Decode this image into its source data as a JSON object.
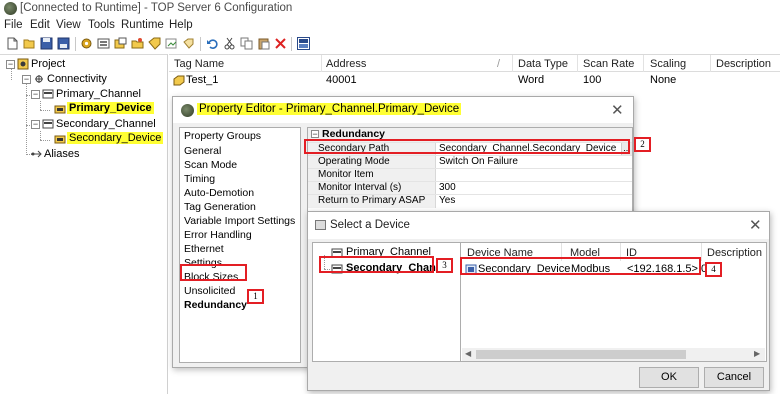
{
  "window": {
    "title": "[Connected to Runtime] - TOP Server 6 Configuration"
  },
  "menu": [
    "File",
    "Edit",
    "View",
    "Tools",
    "Runtime",
    "Help"
  ],
  "toolbar": {
    "icons": [
      "new-icon",
      "open-icon",
      "save-icon",
      "save-as-icon",
      "properties-icon",
      "new-channel-icon",
      "new-device-icon",
      "new-tag-group-icon",
      "new-tag-icon",
      "bulk-tag-icon",
      "undo-icon",
      "cut-icon",
      "copy-icon",
      "paste-icon",
      "delete-icon",
      "quick-client-icon"
    ]
  },
  "tree": {
    "project": "Project",
    "connectivity": "Connectivity",
    "primary_channel": "Primary_Channel",
    "primary_device": "Primary_Device",
    "secondary_channel": "Secondary_Channel",
    "secondary_device": "Secondary_Device",
    "aliases": "Aliases"
  },
  "grid": {
    "columns": [
      "Tag Name",
      "Address",
      "Data Type",
      "Scan Rate",
      "Scaling",
      "Description"
    ],
    "rows": [
      {
        "tag": "Test_1",
        "address": "40001",
        "data_type": "Word",
        "scan_rate": "100",
        "scaling": "None",
        "description": ""
      }
    ]
  },
  "property_editor": {
    "title": "Property Editor - Primary_Channel.Primary_Device",
    "groups": [
      "Property Groups",
      "General",
      "Scan Mode",
      "Timing",
      "Auto-Demotion",
      "Tag Generation",
      "Variable Import Settings",
      "Error Handling",
      "Ethernet",
      "Settings",
      "Block Sizes",
      "Unsolicited",
      "Redundancy"
    ],
    "section": "Redundancy",
    "properties": [
      {
        "key": "Secondary Path",
        "value": "Secondary_Channel.Secondary_Device"
      },
      {
        "key": "Operating Mode",
        "value": "Switch On Failure"
      },
      {
        "key": "Monitor Item",
        "value": ""
      },
      {
        "key": "Monitor Interval (s)",
        "value": "300"
      },
      {
        "key": "Return to Primary ASAP",
        "value": "Yes"
      }
    ],
    "dots": "..."
  },
  "select_device": {
    "title": "Select a Device",
    "channels": [
      "Primary_Channel",
      "Secondary_Channel"
    ],
    "columns": [
      "Device Name",
      "Model",
      "ID",
      "Description"
    ],
    "rows": [
      {
        "name": "Secondary_Device",
        "model": "Modbus",
        "id": "<192.168.1.5>.0",
        "description": ""
      }
    ],
    "ok": "OK",
    "cancel": "Cancel"
  },
  "callouts": [
    "1",
    "2",
    "3",
    "4"
  ],
  "colors": {
    "highlight": "#ffff33",
    "callout_red": "#e31e24"
  }
}
